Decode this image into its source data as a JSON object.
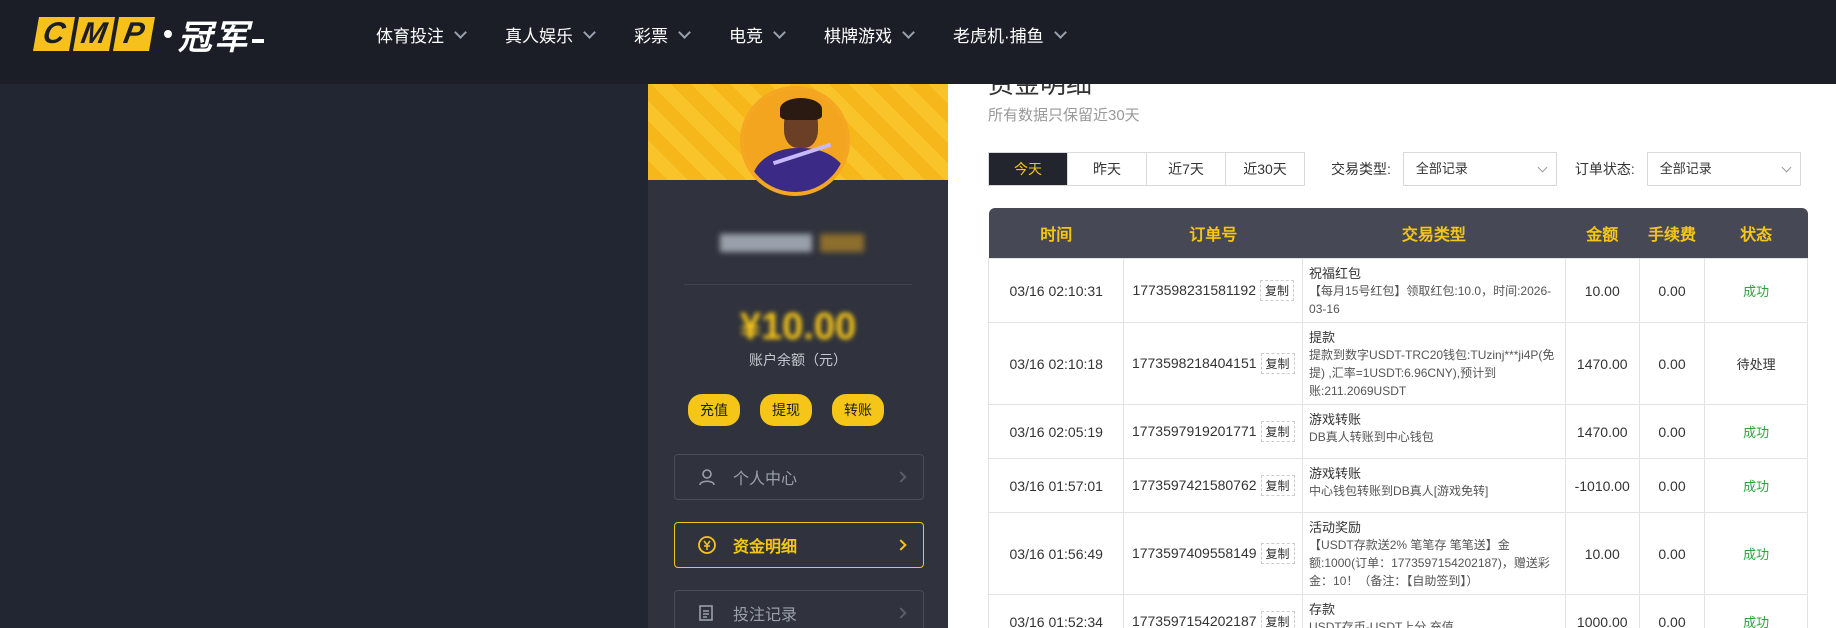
{
  "brand": {
    "boxes": [
      "C",
      "M",
      "P"
    ],
    "name": "冠军"
  },
  "nav": [
    {
      "label": "体育投注"
    },
    {
      "label": "真人娱乐"
    },
    {
      "label": "彩票"
    },
    {
      "label": "电竞"
    },
    {
      "label": "棋牌游戏"
    },
    {
      "label": "老虎机·捕鱼"
    }
  ],
  "sidebar": {
    "balance_label": "账户余额（元）",
    "actions": [
      "充值",
      "提现",
      "转账"
    ],
    "menu": [
      {
        "label": "个人中心",
        "icon": "user-icon",
        "active": false
      },
      {
        "label": "资金明细",
        "icon": "coin-icon",
        "active": true
      },
      {
        "label": "投注记录",
        "icon": "document-icon",
        "active": false
      }
    ]
  },
  "main": {
    "title": "资金明细",
    "subtitle": "所有数据只保留近30天",
    "tabs": [
      "今天",
      "昨天",
      "近7天",
      "近30天"
    ],
    "active_tab": 0,
    "type_label": "交易类型:",
    "type_value": "全部记录",
    "status_label": "订单状态:",
    "status_value": "全部记录",
    "headers": [
      "时间",
      "订单号",
      "交易类型",
      "金额",
      "手续费",
      "状态"
    ],
    "copy_label": "复制",
    "rows": [
      {
        "time": "03/16 02:10:31",
        "order": "1773598231581192",
        "type_title": "祝福红包",
        "type_detail": "【每月15号红包】领取红包:10.0，时间:2026-03-16",
        "amount": "10.00",
        "fee": "0.00",
        "status": "成功",
        "ok": true
      },
      {
        "time": "03/16 02:10:18",
        "order": "1773598218404151",
        "type_title": "提款",
        "type_detail": "提款到数字USDT-TRC20钱包:TUzinj***ji4P(免提) ,汇率=1USDT:6.96CNY),预计到账:211.2069USDT",
        "amount": "1470.00",
        "fee": "0.00",
        "status": "待处理",
        "ok": false
      },
      {
        "time": "03/16 02:05:19",
        "order": "1773597919201771",
        "type_title": "游戏转账",
        "type_detail": "DB真人转账到中心钱包",
        "amount": "1470.00",
        "fee": "0.00",
        "status": "成功",
        "ok": true
      },
      {
        "time": "03/16 01:57:01",
        "order": "1773597421580762",
        "type_title": "游戏转账",
        "type_detail": "中心钱包转账到DB真人[游戏免转]",
        "amount": "-1010.00",
        "fee": "0.00",
        "status": "成功",
        "ok": true
      },
      {
        "time": "03/16 01:56:49",
        "order": "1773597409558149",
        "type_title": "活动奖励",
        "type_detail": "【USDT存款送2% 笔笔存 笔笔送】金额:1000(订单：1773597154202187)，赠送彩金：10！（备注：【自助签到】）",
        "amount": "10.00",
        "fee": "0.00",
        "status": "成功",
        "ok": true
      },
      {
        "time": "03/16 01:52:34",
        "order": "1773597154202187",
        "type_title": "存款",
        "type_detail": "USDT存币-USDT上分 充值",
        "amount": "1000.00",
        "fee": "0.00",
        "status": "成功",
        "ok": true
      }
    ]
  }
}
